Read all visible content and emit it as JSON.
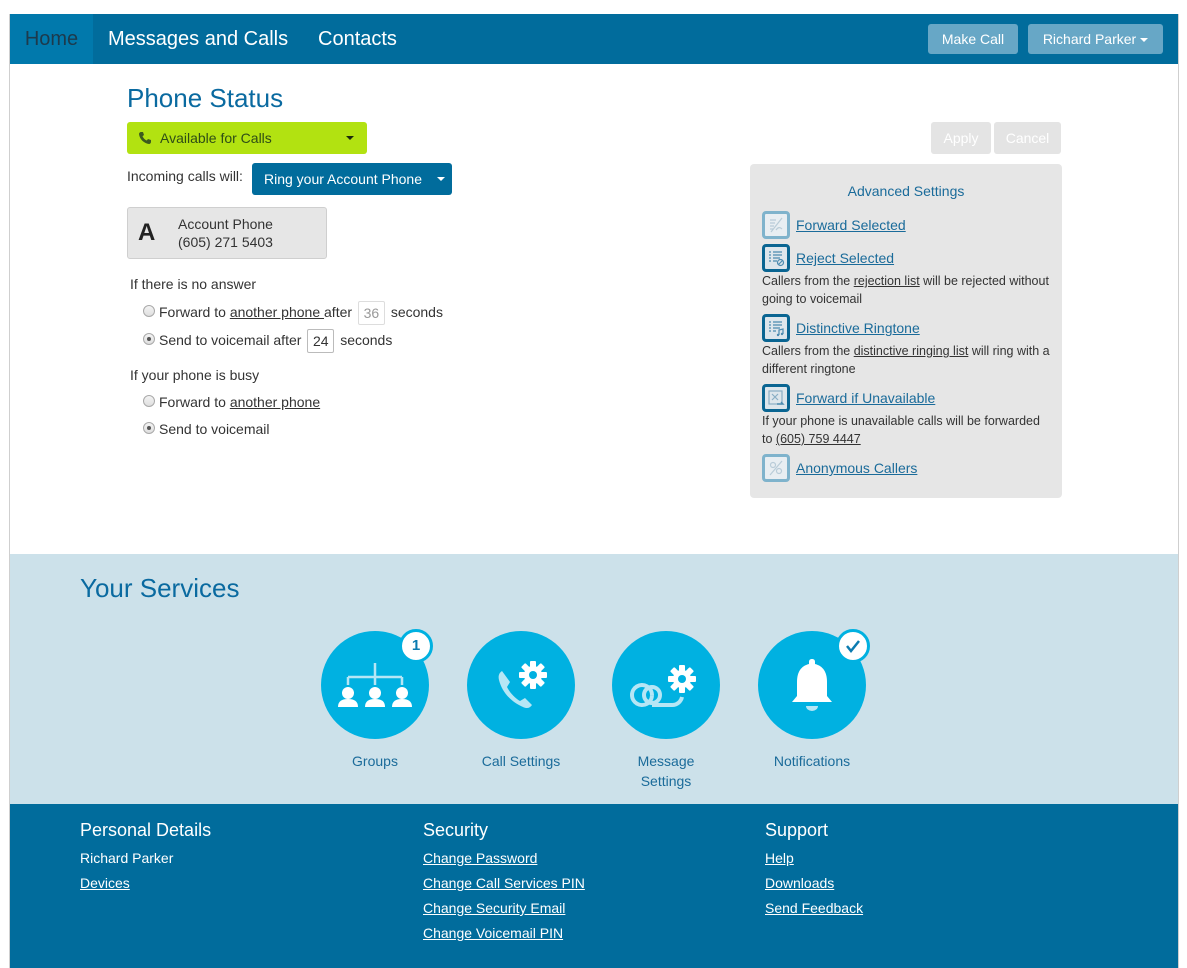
{
  "nav": {
    "tabs": [
      {
        "label": "Home",
        "active": true
      },
      {
        "label": "Messages and Calls",
        "active": false
      },
      {
        "label": "Contacts",
        "active": false
      }
    ],
    "make_call_label": "Make Call",
    "user_label": "Richard Parker"
  },
  "phone_status": {
    "title": "Phone Status",
    "status_value": "Available for Calls",
    "status_color": "#b2e211",
    "incoming_label": "Incoming calls will:",
    "incoming_value": "Ring your Account Phone",
    "account": {
      "letter": "A",
      "name": "Account Phone",
      "number": "(605) 271 5403"
    },
    "no_answer": {
      "label": "If there is no answer",
      "forward": {
        "prefix": "Forward to ",
        "link": "another phone ",
        "middle": "after",
        "seconds": "36",
        "suffix": "seconds",
        "selected": false
      },
      "voicemail": {
        "prefix": "Send to voicemail after",
        "seconds": "24",
        "suffix": "seconds",
        "selected": true
      }
    },
    "busy": {
      "label": "If your phone is busy",
      "forward": {
        "prefix": "Forward to ",
        "link": "another phone",
        "selected": false
      },
      "voicemail": {
        "label": "Send to voicemail",
        "selected": true
      }
    },
    "apply_label": "Apply",
    "cancel_label": "Cancel"
  },
  "advanced": {
    "title": "Advanced Settings",
    "items": [
      {
        "label": "Forward Selected",
        "icon": "forward-selected-icon",
        "enabled": false
      },
      {
        "label": "Reject Selected",
        "icon": "reject-selected-icon",
        "enabled": true,
        "desc_prefix": "Callers from the ",
        "desc_link": "rejection list",
        "desc_suffix": " will be rejected without going to voicemail"
      },
      {
        "label": "Distinctive Ringtone",
        "icon": "distinctive-ringtone-icon",
        "enabled": true,
        "desc_prefix": "Callers from the ",
        "desc_link": "distinctive ringing list",
        "desc_suffix": " will ring with a different ringtone"
      },
      {
        "label": "Forward if Unavailable",
        "icon": "forward-unavailable-icon",
        "enabled": true,
        "desc_prefix": "If your phone is unavailable calls will be forwarded to ",
        "desc_link": "(605) 759 4447",
        "desc_suffix": ""
      },
      {
        "label": "Anonymous Callers",
        "icon": "anonymous-callers-icon",
        "enabled": false
      }
    ]
  },
  "services": {
    "title": "Your Services",
    "items": [
      {
        "label": "Groups",
        "icon": "groups-icon",
        "badge": "1"
      },
      {
        "label": "Call Settings",
        "icon": "call-settings-icon",
        "badge": null
      },
      {
        "label": "Message Settings",
        "icon": "message-settings-icon",
        "badge": null
      },
      {
        "label": "Notifications",
        "icon": "bell-icon",
        "badge": "check"
      }
    ]
  },
  "footer": {
    "personal": {
      "title": "Personal Details",
      "name": "Richard Parker",
      "links": [
        "Devices"
      ]
    },
    "security": {
      "title": "Security",
      "links": [
        "Change Password",
        "Change Call Services PIN",
        "Change Security Email",
        "Change Voicemail PIN"
      ]
    },
    "support": {
      "title": "Support",
      "links": [
        "Help",
        "Downloads",
        "Send Feedback"
      ]
    }
  }
}
